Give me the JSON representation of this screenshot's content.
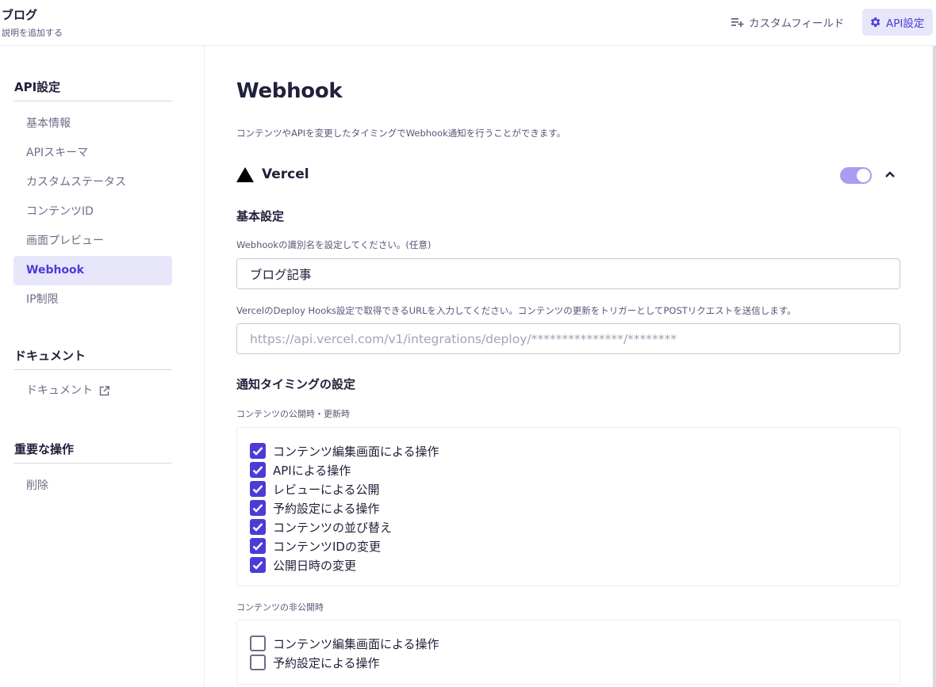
{
  "header": {
    "title": "ブログ",
    "subtitle": "説明を追加する",
    "custom_field_label": "カスタムフィールド",
    "api_settings_label": "API設定"
  },
  "sidebar": {
    "api_heading": "API設定",
    "api_items": [
      {
        "label": "基本情報",
        "active": false
      },
      {
        "label": "APIスキーマ",
        "active": false
      },
      {
        "label": "カスタムステータス",
        "active": false
      },
      {
        "label": "コンテンツID",
        "active": false
      },
      {
        "label": "画面プレビュー",
        "active": false
      },
      {
        "label": "Webhook",
        "active": true
      },
      {
        "label": "IP制限",
        "active": false
      }
    ],
    "doc_heading": "ドキュメント",
    "doc_item": "ドキュメント",
    "danger_heading": "重要な操作",
    "danger_item": "削除"
  },
  "main": {
    "title": "Webhook",
    "description": "コンテンツやAPIを変更したタイミングでWebhook通知を行うことができます。",
    "service_name": "Vercel",
    "service_enabled": true,
    "basic_heading": "基本設定",
    "name_label": "Webhookの識別名を設定してください。(任意)",
    "name_value": "ブログ記事",
    "url_label": "VercelのDeploy Hooks設定で取得できるURLを入力してください。コンテンツの更新をトリガーとしてPOSTリクエストを送信します。",
    "url_placeholder": "https://api.vercel.com/v1/integrations/deploy/***************/********",
    "timing_heading": "通知タイミングの設定",
    "publish_label": "コンテンツの公開時・更新時",
    "publish_options": [
      {
        "label": "コンテンツ編集画面による操作",
        "checked": true
      },
      {
        "label": "APIによる操作",
        "checked": true
      },
      {
        "label": "レビューによる公開",
        "checked": true
      },
      {
        "label": "予約設定による操作",
        "checked": true
      },
      {
        "label": "コンテンツの並び替え",
        "checked": true
      },
      {
        "label": "コンテンツIDの変更",
        "checked": true
      },
      {
        "label": "公開日時の変更",
        "checked": true
      }
    ],
    "unpublish_label": "コンテンツの非公開時",
    "unpublish_options": [
      {
        "label": "コンテンツ編集画面による操作",
        "checked": false
      },
      {
        "label": "予約設定による操作",
        "checked": false
      }
    ]
  },
  "colors": {
    "accent": "#4d3bd8",
    "accent_light": "#e8e6fb",
    "toggle_on": "#a99cf2",
    "text": "#21213b",
    "muted": "#6d6d88"
  }
}
